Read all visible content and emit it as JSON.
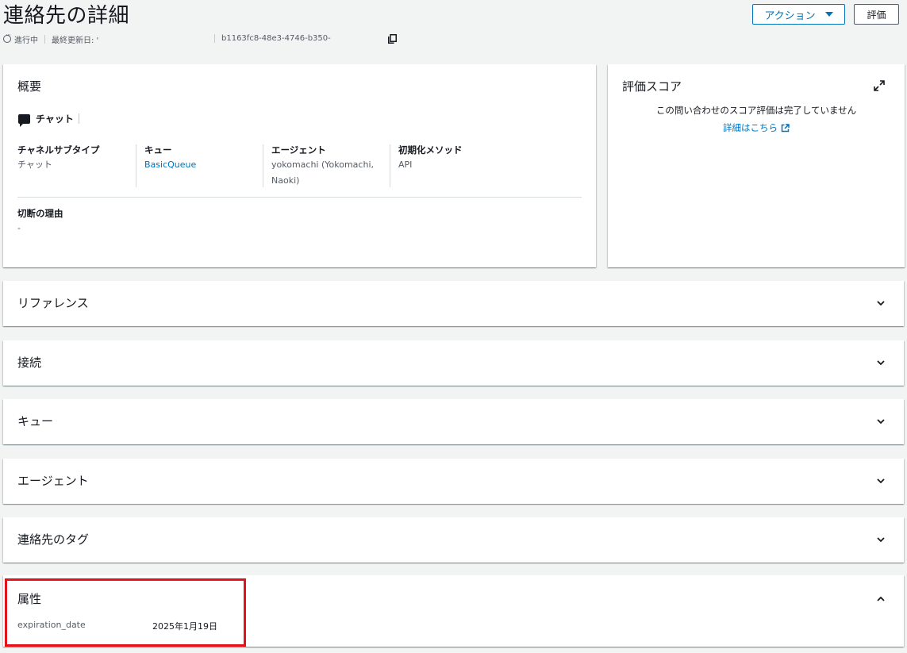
{
  "header": {
    "title": "連絡先の詳細",
    "status": "進行中",
    "last_updated_label": "最終更新日: '",
    "contact_id": "b1163fc8-48e3-4746-b350-",
    "actions_button": "アクション",
    "evaluate_button": "評価"
  },
  "overview": {
    "title": "概要",
    "channel": "チャット",
    "fields": [
      {
        "label": "チャネルサブタイプ",
        "value": "チャット"
      },
      {
        "label": "キュー",
        "value": "BasicQueue"
      },
      {
        "label": "エージェント",
        "value": "yokomachi (Yokomachi, Naoki)"
      },
      {
        "label": "初期化メソッド",
        "value": "API"
      }
    ],
    "disconnect_label": "切断の理由",
    "disconnect_value": "-"
  },
  "score": {
    "title": "評価スコア",
    "message": "この問い合わせのスコア評価は完了していません",
    "link": "詳細はこちら"
  },
  "sections": [
    {
      "title": "リファレンス"
    },
    {
      "title": "接続"
    },
    {
      "title": "キュー"
    },
    {
      "title": "エージェント"
    },
    {
      "title": "連絡先のタグ"
    }
  ],
  "attributes": {
    "title": "属性",
    "items": [
      {
        "key": "expiration_date",
        "value": "2025年1月19日"
      }
    ]
  },
  "colors": {
    "link": "#0073bb",
    "highlight": "#e3131c",
    "background": "#f2f3f3"
  }
}
